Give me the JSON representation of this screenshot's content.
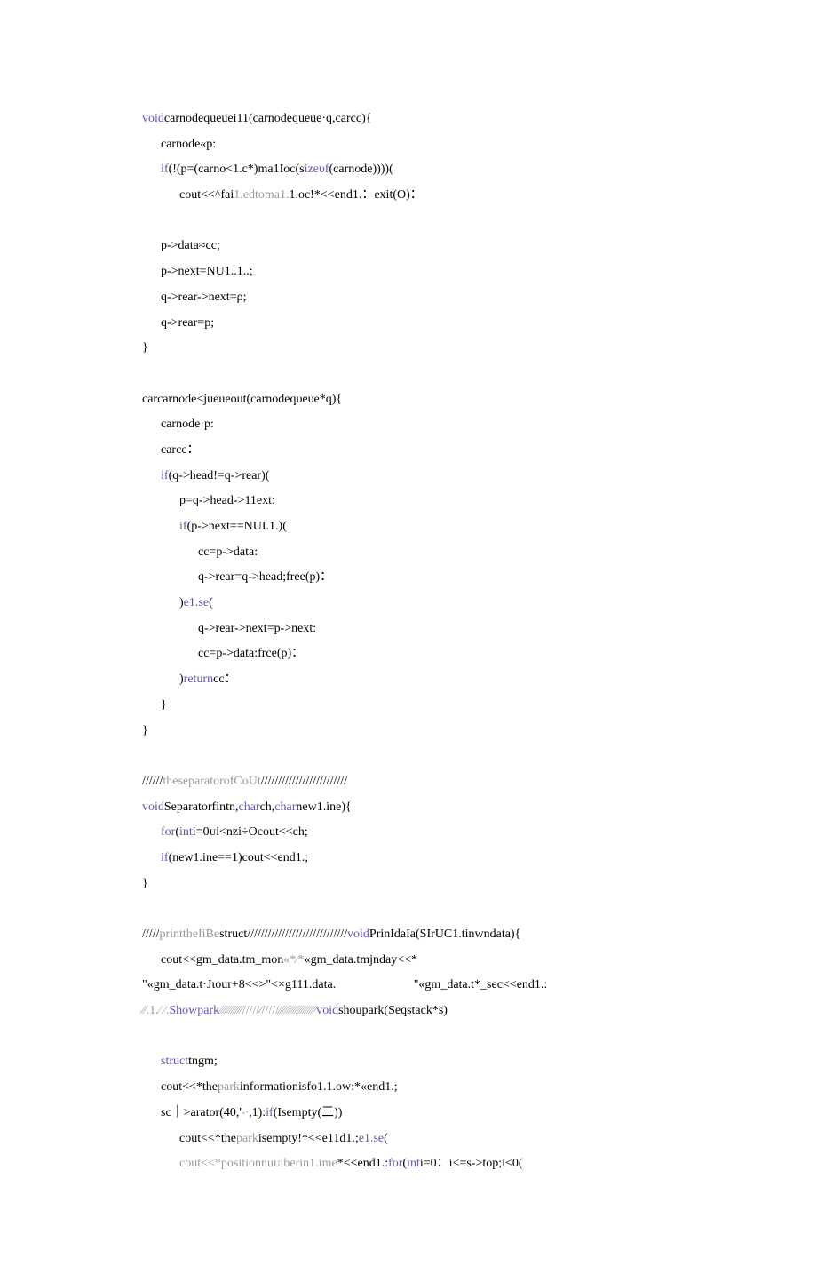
{
  "lines": [
    {
      "i": 0,
      "segs": [
        {
          "t": "void",
          "c": "kw"
        },
        {
          "t": "carnodequeuei11(carnodequeue·q,carcc){"
        }
      ]
    },
    {
      "i": 1,
      "segs": [
        {
          "t": "carnode«p:"
        }
      ]
    },
    {
      "i": 1,
      "segs": [
        {
          "t": "if",
          "c": "kw"
        },
        {
          "t": "(!(p=(carno<1.c*)ma1Ioc(s"
        },
        {
          "t": "izeυf",
          "c": "kw"
        },
        {
          "t": "(carnode))))("
        }
      ]
    },
    {
      "i": 2,
      "segs": [
        {
          "t": "cout<<^fai"
        },
        {
          "t": "1.edtoma1.",
          "c": "cm"
        },
        {
          "t": "1.oc!*<<end1.："
        },
        {
          "t": "exit(O)："
        }
      ]
    },
    {
      "i": 0,
      "segs": [
        {
          "t": " "
        }
      ]
    },
    {
      "i": 1,
      "segs": [
        {
          "t": "p->data≈cc;"
        }
      ]
    },
    {
      "i": 1,
      "segs": [
        {
          "t": "p->next=NU1..1..;"
        }
      ]
    },
    {
      "i": 1,
      "segs": [
        {
          "t": "q->rear->next=ρ;"
        }
      ]
    },
    {
      "i": 1,
      "segs": [
        {
          "t": "q->rear=p;"
        }
      ]
    },
    {
      "i": 0,
      "segs": [
        {
          "t": "}"
        }
      ]
    },
    {
      "i": 0,
      "segs": [
        {
          "t": " "
        }
      ]
    },
    {
      "i": 0,
      "segs": [
        {
          "t": "carcarnode<jueueout(carnodeqυeυe*q){"
        }
      ]
    },
    {
      "i": 1,
      "segs": [
        {
          "t": "carnode·p:"
        }
      ]
    },
    {
      "i": 1,
      "segs": [
        {
          "t": "carcc："
        }
      ]
    },
    {
      "i": 1,
      "segs": [
        {
          "t": "if",
          "c": "kw"
        },
        {
          "t": "(q->head!=q->rear)("
        }
      ]
    },
    {
      "i": 2,
      "segs": [
        {
          "t": "p=q->head->11ext:"
        }
      ]
    },
    {
      "i": 2,
      "segs": [
        {
          "t": "if",
          "c": "kw"
        },
        {
          "t": "(p->next==NUI.1.)("
        }
      ]
    },
    {
      "i": 3,
      "segs": [
        {
          "t": "cc=p->data:"
        }
      ]
    },
    {
      "i": 3,
      "segs": [
        {
          "t": "q->rear=q->head;free(p)："
        }
      ]
    },
    {
      "i": 2,
      "segs": [
        {
          "t": ")"
        },
        {
          "t": "e1.se",
          "c": "kw"
        },
        {
          "t": "("
        }
      ]
    },
    {
      "i": 3,
      "segs": [
        {
          "t": "q->rear->next=p->next:"
        }
      ]
    },
    {
      "i": 3,
      "segs": [
        {
          "t": "cc=p->data:frce(p)："
        }
      ]
    },
    {
      "i": 2,
      "segs": [
        {
          "t": ")"
        },
        {
          "t": "return",
          "c": "kw"
        },
        {
          "t": "cc："
        }
      ]
    },
    {
      "i": 1,
      "segs": [
        {
          "t": "}"
        }
      ]
    },
    {
      "i": 0,
      "segs": [
        {
          "t": "}"
        }
      ]
    },
    {
      "i": 0,
      "segs": [
        {
          "t": " "
        }
      ]
    },
    {
      "i": 0,
      "segs": [
        {
          "t": "//////"
        },
        {
          "t": "theseparatorofCoUt",
          "c": "cm"
        },
        {
          "t": "/////////////////////////"
        }
      ]
    },
    {
      "i": 0,
      "segs": [
        {
          "t": "void",
          "c": "kw"
        },
        {
          "t": "Separatorfintn,"
        },
        {
          "t": "char",
          "c": "kw"
        },
        {
          "t": "ch,"
        },
        {
          "t": "char",
          "c": "kw"
        },
        {
          "t": "new1.ine){"
        }
      ]
    },
    {
      "i": 1,
      "segs": [
        {
          "t": "for",
          "c": "kw"
        },
        {
          "t": "("
        },
        {
          "t": "int",
          "c": "kw"
        },
        {
          "t": "i=0ᴜi<nzi÷Ocout<<ch;"
        }
      ]
    },
    {
      "i": 1,
      "segs": [
        {
          "t": "if",
          "c": "kw"
        },
        {
          "t": "(new1.ine==1)cout<<end1.;"
        }
      ]
    },
    {
      "i": 0,
      "segs": [
        {
          "t": "}"
        }
      ]
    },
    {
      "i": 0,
      "segs": [
        {
          "t": " "
        }
      ]
    },
    {
      "i": 0,
      "segs": [
        {
          "t": "/////"
        },
        {
          "t": "printtheIiBe",
          "c": "cm"
        },
        {
          "t": "struct/////////////////////////////"
        },
        {
          "t": "void",
          "c": "kw"
        },
        {
          "t": "PrinIdaIa(SIrUC1.tinwndata){"
        }
      ]
    },
    {
      "i": 1,
      "segs": [
        {
          "t": "cout<<gm_data.tm_mon"
        },
        {
          "t": "«*⁄*",
          "c": "cm"
        },
        {
          "t": "«gm_data.tmjnday<<*"
        }
      ]
    },
    {
      "i": 0,
      "segs": [
        {
          "t": "\"«gm_data.t·Jιour+8<<>\"<×g111.data.                         \"«gm_data.t*_sec<<end1.:"
        }
      ]
    },
    {
      "i": 0,
      "segs": [
        {
          "t": "∕∕.1.∕.∕.",
          "c": "cm"
        },
        {
          "t": "Showpark",
          "c": "kw"
        },
        {
          "t": "∕∕∕∕∕∕∕∕∕∕∕/////∕/////∕∕∕∕∕∕∕∕∕∕∕∕∕∕∕∕∕∕",
          "c": "cm"
        },
        {
          "t": "void",
          "c": "kw"
        },
        {
          "t": "shoupark(Seqstack*s)"
        }
      ]
    },
    {
      "i": 0,
      "segs": [
        {
          "t": " "
        }
      ]
    },
    {
      "i": 1,
      "segs": [
        {
          "t": "struct",
          "c": "kw"
        },
        {
          "t": "tngm;"
        }
      ]
    },
    {
      "i": 1,
      "segs": [
        {
          "t": "cout<<*the"
        },
        {
          "t": "park",
          "c": "cm"
        },
        {
          "t": "informationisfo1.1.ow:*«end1.;"
        }
      ]
    },
    {
      "i": 1,
      "segs": [
        {
          "t": "sc｜>arator(40,'"
        },
        {
          "t": "-∙",
          "c": "cm"
        },
        {
          "t": ",1):"
        },
        {
          "t": "if",
          "c": "kw"
        },
        {
          "t": "(Isempty(三))"
        }
      ]
    },
    {
      "i": 2,
      "segs": [
        {
          "t": "cout<<*the"
        },
        {
          "t": "park",
          "c": "cm"
        },
        {
          "t": "isempty!*<<e11d1.;"
        },
        {
          "t": "e1.se",
          "c": "kw"
        },
        {
          "t": "("
        }
      ]
    },
    {
      "i": 2,
      "segs": [
        {
          "t": "cout<<*positionnuᴜiberin1.ime",
          "c": "cm"
        },
        {
          "t": "*<<end1.:"
        },
        {
          "t": "for",
          "c": "kw"
        },
        {
          "t": "("
        },
        {
          "t": "int",
          "c": "kw"
        },
        {
          "t": "i=0："
        },
        {
          "t": "i<=s->top;i<0("
        }
      ]
    }
  ]
}
